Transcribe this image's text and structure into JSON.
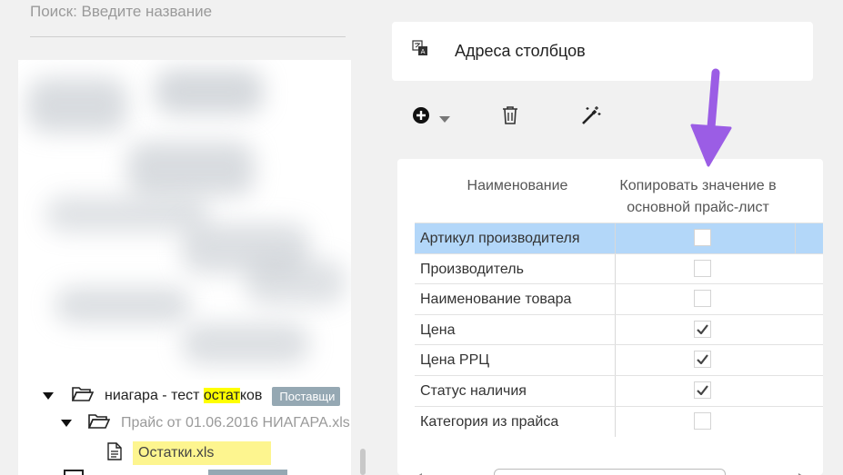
{
  "search": {
    "placeholder": "Поиск: Введите название"
  },
  "tree": {
    "items": [
      {
        "name_before": "ниагара - тест ",
        "name_highlight": "остат",
        "name_after": "ков",
        "badge": "Поставщи"
      },
      {
        "name": "Прайс от 01.06.2016 НИАГАРА.xls"
      },
      {
        "name": "Остатки.xls"
      }
    ]
  },
  "header": {
    "title": "Адреса столбцов"
  },
  "toolbar": {
    "icons": [
      "plus-circle-icon",
      "caret-down-icon",
      "trash-icon",
      "magic-wand-icon"
    ]
  },
  "table": {
    "col_name": "Наименование",
    "col_copy_line1": "Копировать значение в",
    "col_copy_line2": "основной прайс-лист",
    "rows": [
      {
        "label": "Артикул производителя",
        "checked": false,
        "selected": true
      },
      {
        "label": "Производитель",
        "checked": false
      },
      {
        "label": "Наименование товара",
        "checked": false
      },
      {
        "label": "Цена",
        "checked": true
      },
      {
        "label": "Цена РРЦ",
        "checked": true
      },
      {
        "label": "Статус наличия",
        "checked": true
      },
      {
        "label": "Категория из прайса",
        "checked": false
      }
    ]
  },
  "colors": {
    "selected_row": "#b3d7f9",
    "highlight": "#ffff00",
    "arrow": "#9b5de5",
    "badge": "#95a8b3"
  }
}
